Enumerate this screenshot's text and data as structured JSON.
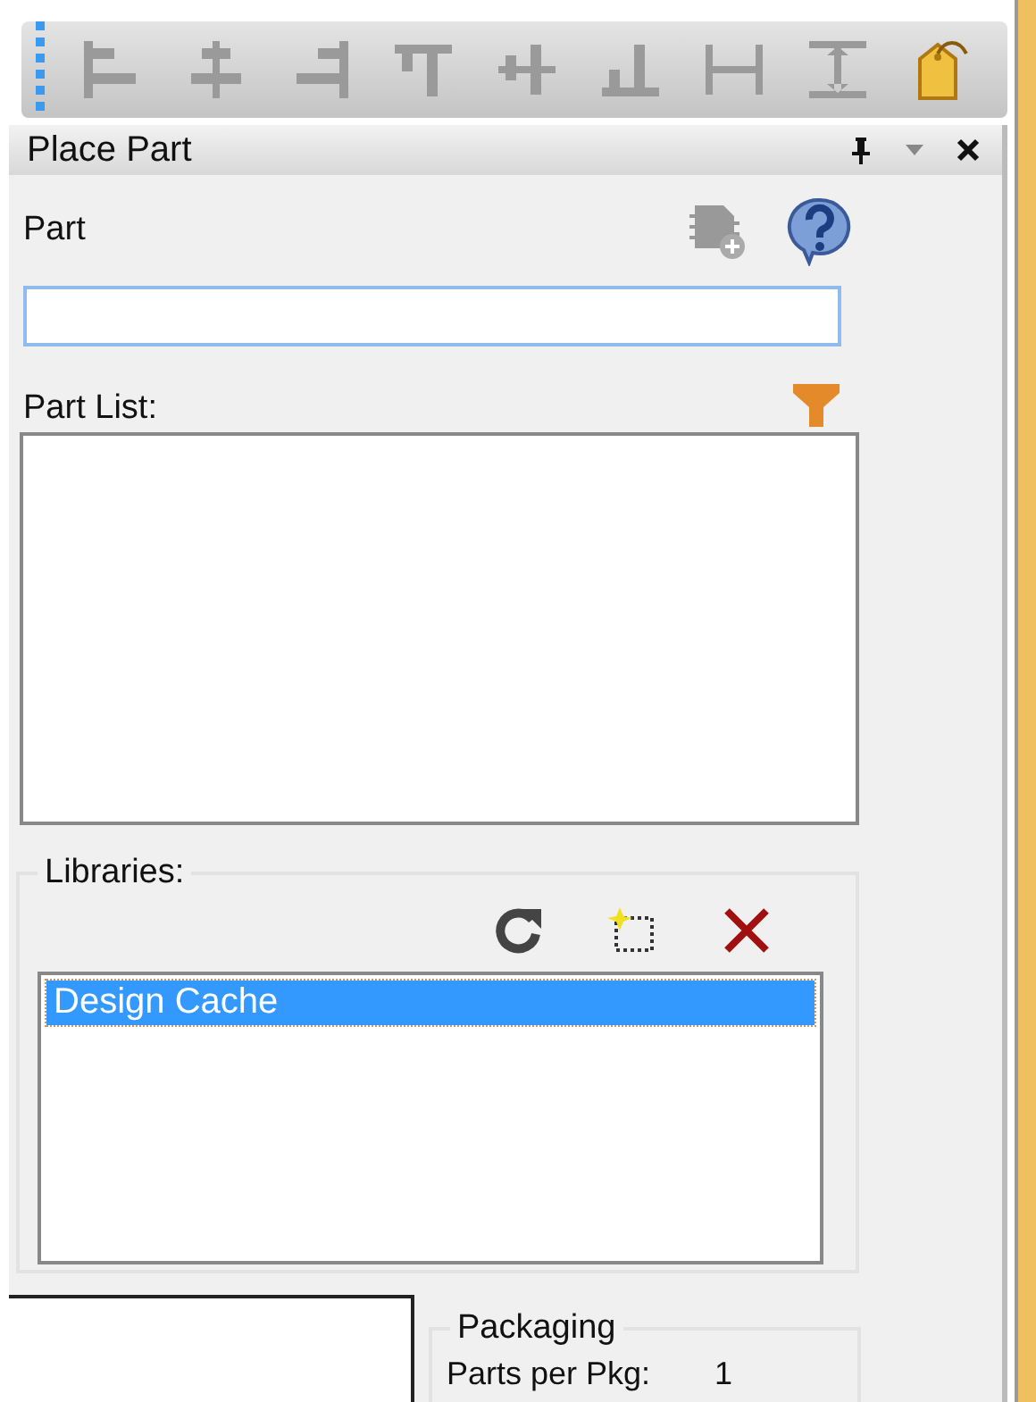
{
  "toolbar": {
    "items": [
      {
        "kind": "align-left",
        "disabled": true
      },
      {
        "kind": "align-center",
        "disabled": true
      },
      {
        "kind": "align-right",
        "disabled": true
      },
      {
        "kind": "align-top",
        "disabled": true
      },
      {
        "kind": "align-middle",
        "disabled": true
      },
      {
        "kind": "align-bottom",
        "disabled": true
      },
      {
        "kind": "distribute-h",
        "disabled": true
      },
      {
        "kind": "distribute-v",
        "disabled": true
      },
      {
        "kind": "tag",
        "disabled": false
      }
    ]
  },
  "panel": {
    "title": "Place Part",
    "part_label": "Part",
    "part_list_label": "Part List:",
    "libraries_label": "Libraries:",
    "libraries": [
      {
        "name": "Design Cache",
        "selected": true
      }
    ],
    "packaging": {
      "title": "Packaging",
      "rows": [
        {
          "label": "Parts per Pkg:",
          "value": "1"
        }
      ]
    }
  }
}
